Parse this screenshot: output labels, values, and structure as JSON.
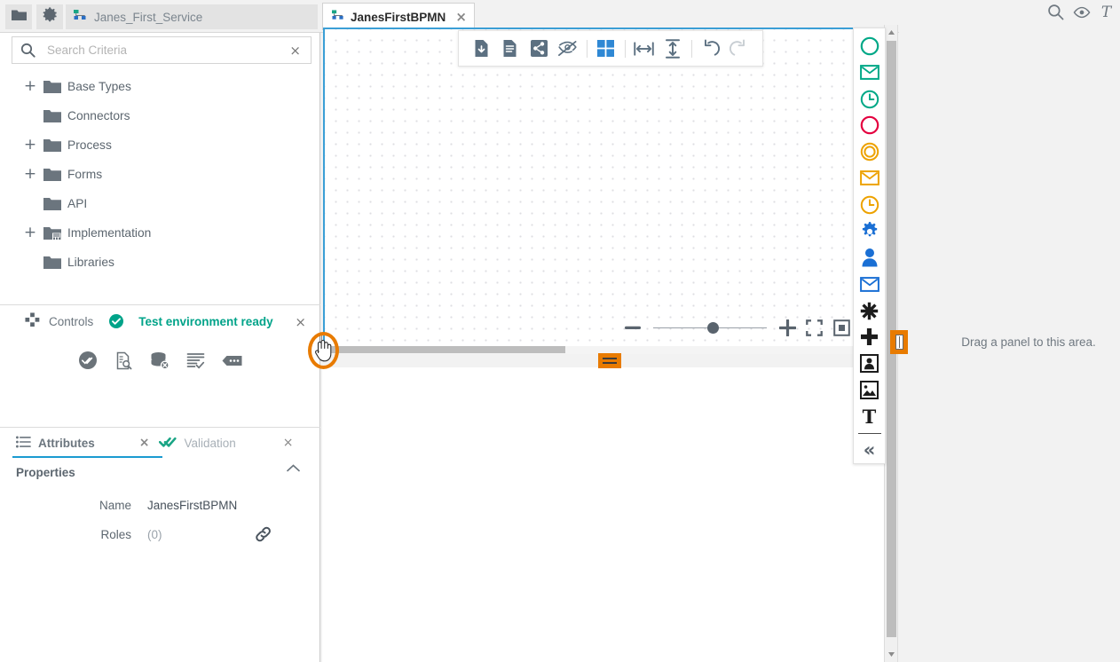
{
  "topbar": {
    "folder_button": "folder-icon",
    "settings_button": "gear-icon",
    "breadcrumb": "Janes_First_Service",
    "tab": {
      "label": "JanesFirstBPMN",
      "close": "×"
    },
    "right_icons": [
      "search-icon",
      "eye-icon",
      "text-icon"
    ]
  },
  "sidebar": {
    "search": {
      "placeholder": "Search Criteria",
      "value": "",
      "clear": "×"
    },
    "tree": [
      {
        "label": "Base Types",
        "expandable": true,
        "icon": "folder-icon"
      },
      {
        "label": "Connectors",
        "expandable": false,
        "icon": "folder-icon"
      },
      {
        "label": "Process",
        "expandable": true,
        "icon": "folder-icon"
      },
      {
        "label": "Forms",
        "expandable": true,
        "icon": "folder-icon"
      },
      {
        "label": "API",
        "expandable": false,
        "icon": "folder-icon"
      },
      {
        "label": "Implementation",
        "expandable": true,
        "icon": "folder-impl-icon"
      },
      {
        "label": "Libraries",
        "expandable": false,
        "icon": "folder-icon"
      }
    ],
    "controls": {
      "title": "Controls",
      "status": "Test environment ready",
      "status_color": "#00a389",
      "close": "×",
      "icons": [
        "validate-all-icon",
        "inspect-document-icon",
        "clear-database-icon",
        "log-check-icon",
        "more-options-icon"
      ]
    },
    "attributes": {
      "tabs": [
        {
          "label": "Attributes",
          "selected": true,
          "icon": "list-icon",
          "close": "×"
        },
        {
          "label": "Validation",
          "selected": false,
          "icon": "check-icon",
          "close": "×"
        }
      ],
      "section_title": "Properties",
      "collapse": "chevron-up-icon",
      "rows": [
        {
          "label": "Name",
          "value": "JanesFirstBPMN",
          "muted": false,
          "link": false
        },
        {
          "label": "Roles",
          "value": "(0)",
          "muted": true,
          "link": true
        }
      ]
    }
  },
  "canvas": {
    "toolbar": [
      "import-icon",
      "document-icon",
      "share-icon",
      "hide-icon",
      "grid-icon",
      "fit-horizontal-icon",
      "fit-vertical-icon",
      "undo-icon",
      "redo-icon"
    ],
    "zoom_top": {
      "minus": "−",
      "plus": "+",
      "knob_pct": 48,
      "fullscreen": "fullscreen-icon",
      "fit": "fit-icon"
    },
    "zoom_bottom": {
      "minus": "−",
      "plus": "+",
      "knob_pct": 48,
      "fullscreen": "fullscreen-icon",
      "fit": "fit-icon"
    },
    "palette": [
      {
        "name": "start-event",
        "glyph": "circle",
        "color": "#00a887"
      },
      {
        "name": "message-start-event",
        "glyph": "envelope",
        "color": "#00a887"
      },
      {
        "name": "timer-start-event",
        "glyph": "clock",
        "color": "#00a887"
      },
      {
        "name": "end-event",
        "glyph": "circle",
        "color": "#e4003f"
      },
      {
        "name": "intermediate-event",
        "glyph": "ring",
        "color": "#eda200"
      },
      {
        "name": "message-intermediate",
        "glyph": "envelope",
        "color": "#eda200"
      },
      {
        "name": "timer-intermediate",
        "glyph": "clock",
        "color": "#eda200"
      },
      {
        "name": "service-task",
        "glyph": "gear",
        "color": "#1a6fd4"
      },
      {
        "name": "user-task",
        "glyph": "person",
        "color": "#1a6fd4"
      },
      {
        "name": "send-task",
        "glyph": "envelope",
        "color": "#1a6fd4"
      },
      {
        "name": "complex-gateway",
        "glyph": "asterisk",
        "color": "#1c1c1c"
      },
      {
        "name": "parallel-gateway",
        "glyph": "plus",
        "color": "#1c1c1c"
      },
      {
        "name": "pool",
        "glyph": "pool",
        "color": "#1c1c1c"
      },
      {
        "name": "image-annotation",
        "glyph": "image",
        "color": "#1c1c1c"
      },
      {
        "name": "text-annotation",
        "glyph": "text",
        "color": "#1c1c1c"
      }
    ],
    "palette_collapse": "«"
  },
  "right_panel": {
    "drop_hint": "Drag a panel to this area.",
    "handle": "panel-drag-handle"
  }
}
